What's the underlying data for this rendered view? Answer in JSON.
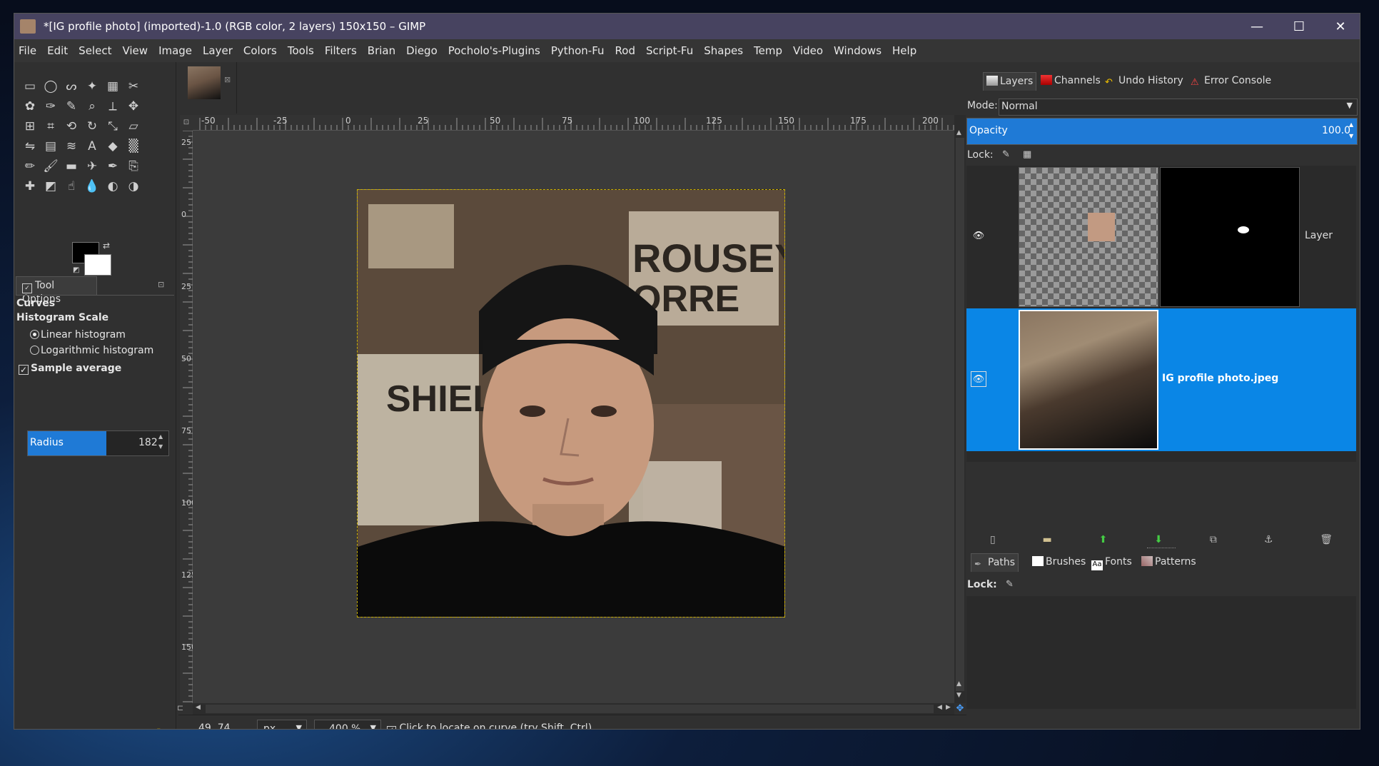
{
  "window": {
    "title": "*[IG profile photo] (imported)-1.0 (RGB color, 2 layers) 150x150 – GIMP",
    "minimize": "—",
    "maximize": "☐",
    "close": "✕"
  },
  "menubar": [
    "File",
    "Edit",
    "Select",
    "View",
    "Image",
    "Layer",
    "Colors",
    "Tools",
    "Filters",
    "Brian",
    "Diego",
    "Pocholo's-Plugins",
    "Python-Fu",
    "Rod",
    "Script-Fu",
    "Shapes",
    "Temp",
    "Video",
    "Windows",
    "Help"
  ],
  "toolbox": {
    "tool_icons": [
      "rect-select-icon",
      "ellipse-select-icon",
      "free-select-icon",
      "fuzzy-select-icon",
      "by-color-select-icon",
      "scissors-select-icon",
      "foreground-select-icon",
      "paths-icon",
      "color-picker-icon",
      "zoom-icon",
      "measure-icon",
      "move-icon",
      "align-icon",
      "crop-icon",
      "unified-transform-icon",
      "rotate-icon",
      "scale-icon",
      "shear-icon",
      "flip-icon",
      "cage-icon",
      "warp-icon",
      "text-icon",
      "bucket-fill-icon",
      "gradient-icon",
      "pencil-icon",
      "paintbrush-icon",
      "eraser-icon",
      "airbrush-icon",
      "ink-icon",
      "clone-icon",
      "heal-icon",
      "perspective-clone-icon",
      "smudge-icon",
      "blur-icon",
      "dodge-icon",
      "burn-icon"
    ],
    "fg_color": "#000000",
    "bg_color": "#ffffff"
  },
  "tool_options": {
    "tab": "Tool Options",
    "tool_name": "Curves",
    "histogram_scale_label": "Histogram Scale",
    "linear": "Linear histogram",
    "logarithmic": "Logarithmic histogram",
    "selected_scale": "linear",
    "sample_average": "Sample average",
    "sample_average_checked": true,
    "radius_label": "Radius",
    "radius_value": "182"
  },
  "ruler_top": [
    "-50",
    "-25",
    "0",
    "25",
    "50",
    "75",
    "100",
    "125",
    "150",
    "175",
    "200"
  ],
  "ruler_left": [
    "25",
    "0",
    "25",
    "50",
    "75",
    "100",
    "125",
    "150"
  ],
  "status": {
    "coords": "49, 74",
    "unit": "px",
    "zoom": "400 %",
    "message": "Click to locate on curve (try Shift, Ctrl)"
  },
  "layers_dock": {
    "tabs": [
      "Layers",
      "Channels",
      "Undo History",
      "Error Console"
    ],
    "mode_label": "Mode:",
    "mode_value": "Normal",
    "opacity_label": "Opacity",
    "opacity_value": "100.0",
    "lock_label": "Lock:",
    "layers": [
      {
        "name": "Layer",
        "visible": true,
        "selected": false
      },
      {
        "name": "IG profile photo.jpeg",
        "visible": true,
        "selected": true
      }
    ]
  },
  "paths_dock": {
    "tabs": [
      "Paths",
      "Brushes",
      "Fonts",
      "Patterns"
    ],
    "lock_label": "Lock:"
  },
  "colors": {
    "accent": "#1f7ad6",
    "selected_row": "#0a86e6",
    "titlebar": "#474360"
  }
}
